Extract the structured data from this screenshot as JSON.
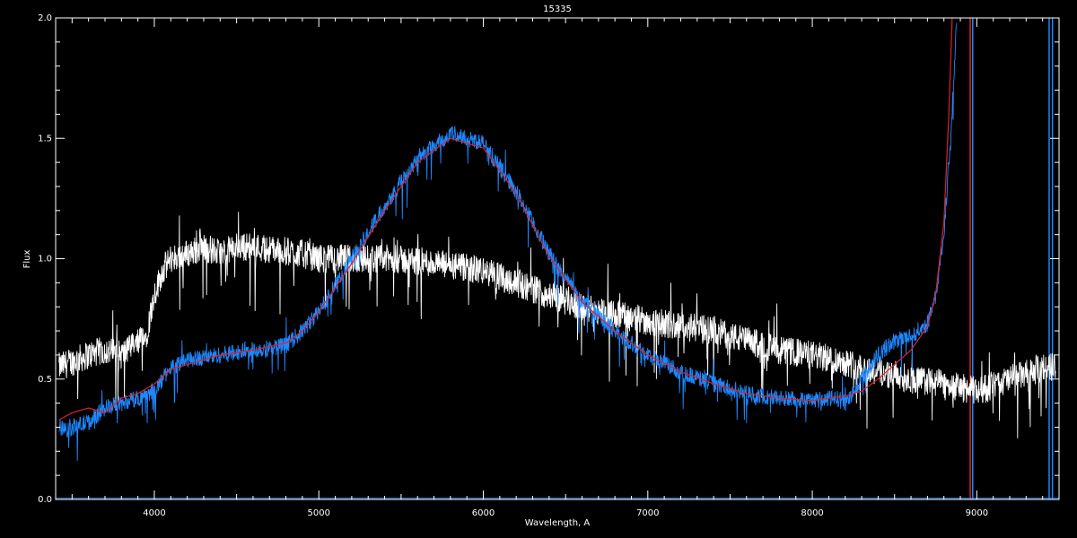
{
  "chart_data": {
    "type": "line",
    "title": "15335",
    "xlabel": "Wavelength, A",
    "ylabel": "Flux",
    "xlim": [
      3400,
      9500
    ],
    "ylim": [
      0,
      2.0
    ],
    "xticks": [
      4000,
      5000,
      6000,
      7000,
      8000,
      9000
    ],
    "xtick_labels": [
      "4000",
      "5000",
      "6000",
      "7000",
      "8000",
      "9000"
    ],
    "yticks": [
      0.0,
      0.5,
      1.0,
      1.5,
      2.0
    ],
    "ytick_labels": [
      "0.0",
      "0.5",
      "1.0",
      "1.5",
      "2.0"
    ],
    "grid": false,
    "colors": {
      "background": "#000000",
      "axes": "#ffffff"
    },
    "series": [
      {
        "color": "#ffffff",
        "noise": 0.06,
        "x": [
          3420,
          3600,
          3700,
          3800,
          3900,
          3950,
          4000,
          4050,
          4100,
          4200,
          4300,
          4400,
          4500,
          4600,
          4700,
          4800,
          4900,
          5000,
          5200,
          5400,
          5600,
          5800,
          6000,
          6200,
          6400,
          6600,
          6800,
          7000,
          7200,
          7400,
          7600,
          7800,
          8000,
          8200,
          8400,
          8600,
          8800,
          9000,
          9100,
          9200,
          9300,
          9400,
          9480
        ],
        "y": [
          0.55,
          0.6,
          0.62,
          0.6,
          0.65,
          0.68,
          0.85,
          0.95,
          1.0,
          1.02,
          1.05,
          1.02,
          1.05,
          1.05,
          1.04,
          1.03,
          1.02,
          1.0,
          1.0,
          1.0,
          0.99,
          0.97,
          0.95,
          0.9,
          0.85,
          0.8,
          0.77,
          0.74,
          0.72,
          0.7,
          0.66,
          0.62,
          0.6,
          0.57,
          0.53,
          0.5,
          0.48,
          0.45,
          0.47,
          0.5,
          0.52,
          0.55,
          0.55
        ]
      },
      {
        "color": "#1e88ff",
        "noise": 0.035,
        "x": [
          3420,
          3500,
          3600,
          3700,
          3800,
          3900,
          4000,
          4100,
          4200,
          4400,
          4600,
          4800,
          4900,
          5000,
          5200,
          5400,
          5600,
          5800,
          6000,
          6200,
          6400,
          6600,
          6800,
          7000,
          7200,
          7400,
          7600,
          7800,
          8000,
          8150,
          8200,
          8300,
          8400,
          8500,
          8600,
          8700,
          8750,
          8800,
          8850,
          8880
        ],
        "y": [
          0.3,
          0.3,
          0.32,
          0.38,
          0.4,
          0.42,
          0.45,
          0.55,
          0.58,
          0.6,
          0.62,
          0.64,
          0.7,
          0.78,
          1.0,
          1.22,
          1.42,
          1.52,
          1.48,
          1.28,
          1.02,
          0.82,
          0.7,
          0.6,
          0.53,
          0.48,
          0.44,
          0.42,
          0.41,
          0.42,
          0.4,
          0.5,
          0.6,
          0.66,
          0.68,
          0.73,
          0.85,
          1.1,
          1.6,
          2.05
        ]
      },
      {
        "color": "#e0202a",
        "noise": 0,
        "x": [
          3420,
          3500,
          3600,
          3700,
          3800,
          3900,
          4000,
          4100,
          4200,
          4400,
          4600,
          4800,
          4900,
          5000,
          5200,
          5400,
          5600,
          5800,
          6000,
          6200,
          6400,
          6600,
          6800,
          7000,
          7200,
          7400,
          7600,
          7800,
          8000,
          8200,
          8300,
          8400,
          8500,
          8600,
          8700,
          8750,
          8800,
          8830,
          8850
        ],
        "y": [
          0.33,
          0.36,
          0.38,
          0.36,
          0.42,
          0.44,
          0.48,
          0.54,
          0.56,
          0.6,
          0.62,
          0.65,
          0.7,
          0.78,
          0.98,
          1.2,
          1.4,
          1.5,
          1.46,
          1.27,
          1.01,
          0.82,
          0.7,
          0.6,
          0.53,
          0.48,
          0.44,
          0.42,
          0.41,
          0.43,
          0.45,
          0.5,
          0.56,
          0.62,
          0.72,
          0.85,
          1.15,
          1.6,
          2.05
        ]
      }
    ],
    "vertical_lines": [
      {
        "x": 8960,
        "color": "#e0202a"
      },
      {
        "x": 8975,
        "color": "#1e88ff"
      },
      {
        "x": 9440,
        "color": "#1e88ff"
      },
      {
        "x": 9460,
        "color": "#1e88ff"
      }
    ]
  }
}
